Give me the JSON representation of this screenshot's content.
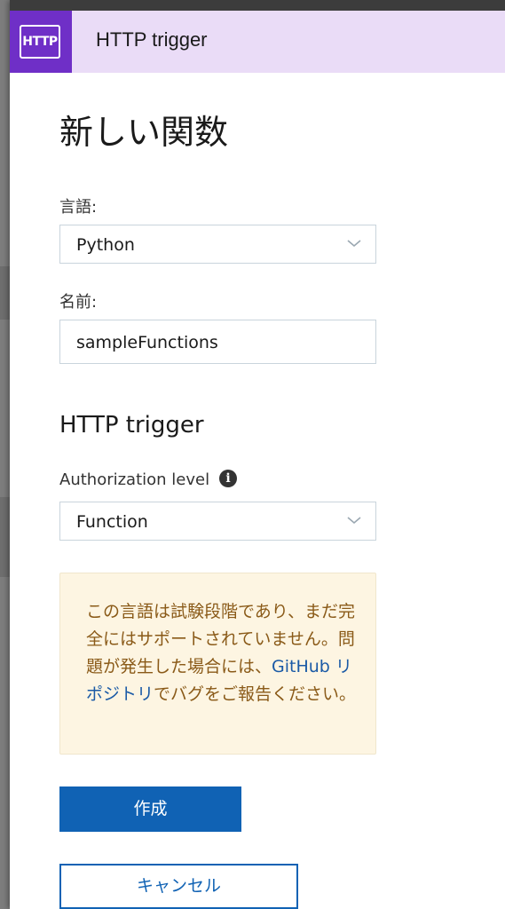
{
  "header": {
    "logo_text": "HTTP",
    "title": "HTTP trigger"
  },
  "form": {
    "page_title": "新しい関数",
    "language_label": "言語:",
    "language_value": "Python",
    "name_label": "名前:",
    "name_value": "sampleFunctions",
    "section_title": "HTTP trigger",
    "auth_label": "Authorization level",
    "auth_value": "Function"
  },
  "notice": {
    "text_before": "この言語は試験段階であり、まだ完全にはサポートされていません。問題が発生した場合には、",
    "link_text": "GitHub リポジトリ",
    "text_after": "でバグをご報告ください。"
  },
  "buttons": {
    "create_label": "作成",
    "cancel_label": "キャンセル"
  },
  "colors": {
    "header_bg": "#eadcf7",
    "logo_bg": "#6f2fc7",
    "primary": "#1062b4",
    "notice_bg": "#fdf5e2",
    "notice_text": "#8a5a18"
  },
  "icons": {
    "logo": "http-logo-icon",
    "dropdown": "chevron-down-icon",
    "info": "info-icon"
  }
}
